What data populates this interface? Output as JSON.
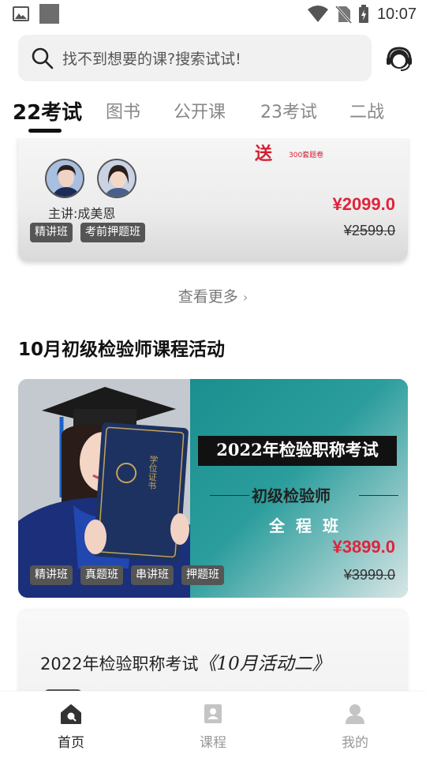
{
  "status_bar": {
    "time": "10:07"
  },
  "search": {
    "placeholder": "找不到想要的课?搜索试试!"
  },
  "tabs": [
    {
      "label": "22考试",
      "active": true
    },
    {
      "label": "图书"
    },
    {
      "label": "公开课"
    },
    {
      "label": "23考试"
    },
    {
      "label": "二战"
    }
  ],
  "course_card": {
    "promo_text": "送",
    "promo_sub": "300套题卷",
    "teacher": "主讲:成美恩",
    "price": "¥2099.0",
    "original_price": "¥2599.0",
    "tags": [
      "精讲班",
      "考前押题班"
    ]
  },
  "view_more": "查看更多",
  "section": {
    "title": "10月初级检验师课程活动",
    "banner": {
      "headline": "2022年检验职称考试",
      "subtitle": "初级检验师",
      "subtitle2": "全程班",
      "certificate_text": "学位证书",
      "price": "¥3899.0",
      "original_price": "¥3999.0",
      "tags": [
        "精讲班",
        "真题班",
        "串讲班",
        "押题班"
      ]
    },
    "next_card": {
      "title_prefix": "2022年检验职称考试",
      "title_hand": "《10月活动二》"
    }
  },
  "bottom_nav": [
    {
      "label": "首页",
      "icon": "home-icon",
      "active": true
    },
    {
      "label": "课程",
      "icon": "course-icon"
    },
    {
      "label": "我的",
      "icon": "profile-icon"
    }
  ],
  "colors": {
    "price_red": "#e0233c",
    "banner_teal": "#1f8d8e",
    "tag_gray": "#555555"
  }
}
